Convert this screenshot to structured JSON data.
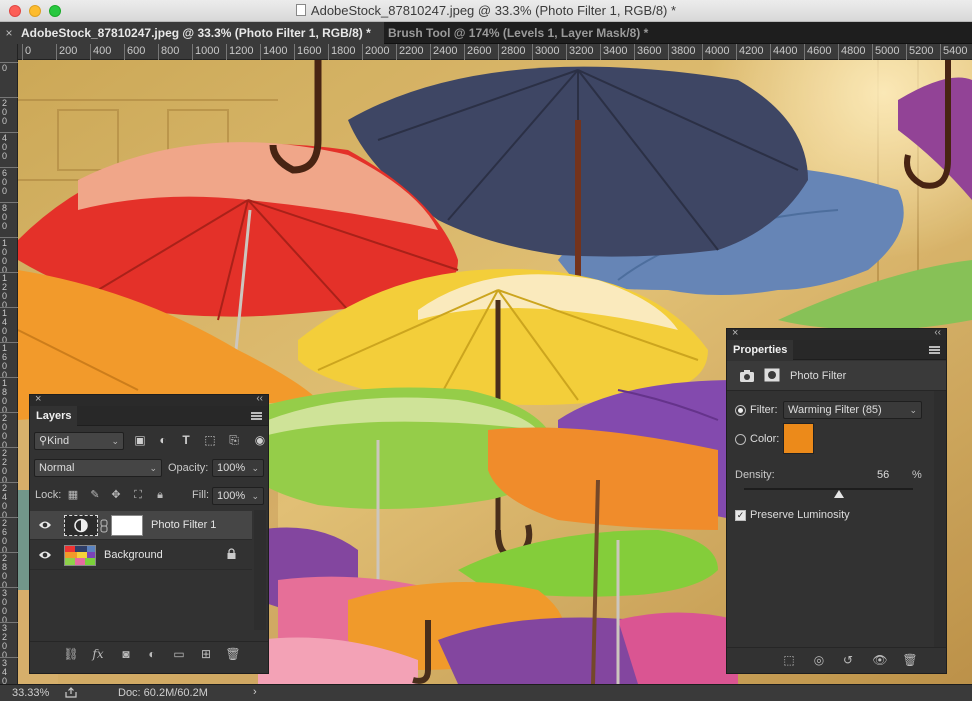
{
  "window": {
    "title": "AdobeStock_87810247.jpeg @ 33.3% (Photo Filter 1, RGB/8) *"
  },
  "tabs": [
    {
      "label": "AdobeStock_87810247.jpeg @ 33.3% (Photo Filter 1, RGB/8) *",
      "active": true
    },
    {
      "label": "Brush Tool @ 174% (Levels 1, Layer Mask/8) *",
      "active": false
    }
  ],
  "ruler": {
    "top_labels": [
      "0",
      "200",
      "400",
      "600",
      "800",
      "1000",
      "1200",
      "1400",
      "1600",
      "1800",
      "2000",
      "2200",
      "2400",
      "2600",
      "2800",
      "3000",
      "3200",
      "3400",
      "3600",
      "3800",
      "4000",
      "4200",
      "4400",
      "4600",
      "4800",
      "5000",
      "5200",
      "5400"
    ],
    "left_labels": [
      "0",
      "200",
      "400",
      "600",
      "800",
      "1000",
      "1200",
      "1400",
      "1600",
      "1800",
      "2000",
      "2200",
      "2400",
      "2600",
      "2800",
      "3000",
      "3200",
      "3400"
    ]
  },
  "layers_panel": {
    "tab_label": "Layers",
    "kind_label": "Kind",
    "blend_mode": "Normal",
    "opacity_label": "Opacity:",
    "opacity_value": "100%",
    "lock_label": "Lock:",
    "fill_label": "Fill:",
    "fill_value": "100%",
    "layers": [
      {
        "name": "Photo Filter 1",
        "selected": true
      },
      {
        "name": "Background",
        "selected": false
      }
    ],
    "footer_fx": "fx"
  },
  "properties_panel": {
    "tab_label": "Properties",
    "section_title": "Photo Filter",
    "filter_label": "Filter:",
    "filter_value": "Warming Filter (85)",
    "color_label": "Color:",
    "color_value": "#ec8a1a",
    "density_label": "Density:",
    "density_value": "56",
    "density_unit": "%",
    "preserve_label": "Preserve Luminosity",
    "preserve_checked": true
  },
  "status": {
    "zoom": "33.33%",
    "doc": "Doc: 60.2M/60.2M",
    "arrow": "›"
  },
  "colors": {
    "filter_swatch": "#ec8a1a",
    "panel_bg": "#323232",
    "ui_bg": "#282828"
  }
}
